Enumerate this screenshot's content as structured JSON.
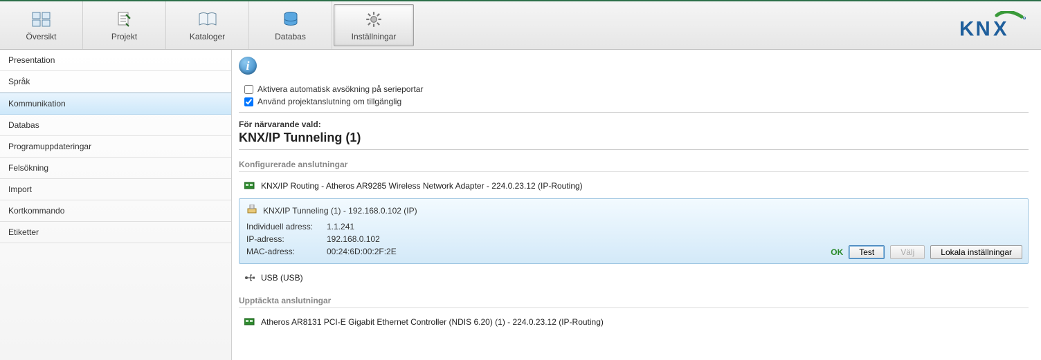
{
  "brand": "KNX",
  "topnav": {
    "items": [
      {
        "label": "Översikt"
      },
      {
        "label": "Projekt"
      },
      {
        "label": "Kataloger"
      },
      {
        "label": "Databas"
      },
      {
        "label": "Inställningar"
      }
    ]
  },
  "sidebar": {
    "items": [
      {
        "label": "Presentation"
      },
      {
        "label": "Språk"
      },
      {
        "label": "Kommunikation"
      },
      {
        "label": "Databas"
      },
      {
        "label": "Programuppdateringar"
      },
      {
        "label": "Felsökning"
      },
      {
        "label": "Import"
      },
      {
        "label": "Kortkommando"
      },
      {
        "label": "Etiketter"
      }
    ],
    "selected_index": 2
  },
  "checks": {
    "serial_label": "Aktivera automatisk avsökning på serieportar",
    "serial_checked": false,
    "project_label": "Använd projektanslutning om tillgänglig",
    "project_checked": true
  },
  "selection": {
    "heading": "För närvarande vald:",
    "title": "KNX/IP Tunneling (1)"
  },
  "configured": {
    "heading": "Konfigurerade anslutningar",
    "items": [
      {
        "label": "KNX/IP Routing - Atheros AR9285 Wireless Network Adapter - 224.0.23.12 (IP-Routing)"
      }
    ],
    "selected": {
      "title": "KNX/IP Tunneling (1) - 192.168.0.102 (IP)",
      "rows": [
        {
          "k": "Individuell adress:",
          "v": "1.1.241"
        },
        {
          "k": "IP-adress:",
          "v": "192.168.0.102"
        },
        {
          "k": "MAC-adress:",
          "v": "00:24:6D:00:2F:2E"
        }
      ],
      "status": "OK",
      "buttons": {
        "test": "Test",
        "select": "Välj",
        "local": "Lokala inställningar"
      }
    },
    "trailing": [
      {
        "label": "USB (USB)"
      }
    ]
  },
  "discovered": {
    "heading": "Upptäckta anslutningar",
    "items": [
      {
        "label": "Atheros AR8131 PCI-E Gigabit Ethernet Controller (NDIS 6.20) (1) - 224.0.23.12 (IP-Routing)"
      }
    ]
  }
}
